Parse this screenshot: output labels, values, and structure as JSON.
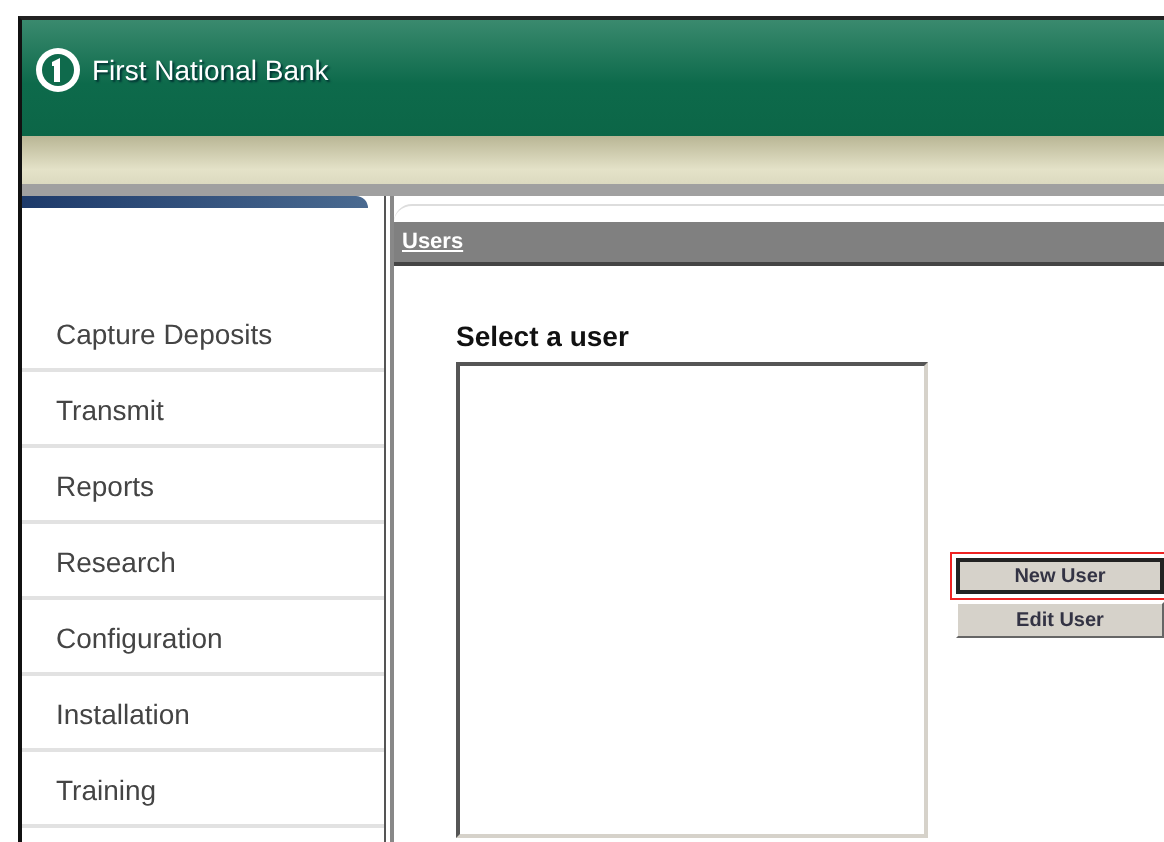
{
  "header": {
    "bank_name": "First National Bank"
  },
  "sidebar": {
    "items": [
      {
        "label": "Capture Deposits"
      },
      {
        "label": "Transmit"
      },
      {
        "label": "Reports"
      },
      {
        "label": "Research"
      },
      {
        "label": "Configuration"
      },
      {
        "label": "Installation"
      },
      {
        "label": "Training"
      }
    ]
  },
  "panel": {
    "title": "Users",
    "heading": "Select a user",
    "buttons": [
      {
        "label": "New User",
        "highlighted": true
      },
      {
        "label": "Edit User",
        "highlighted": false
      }
    ]
  }
}
